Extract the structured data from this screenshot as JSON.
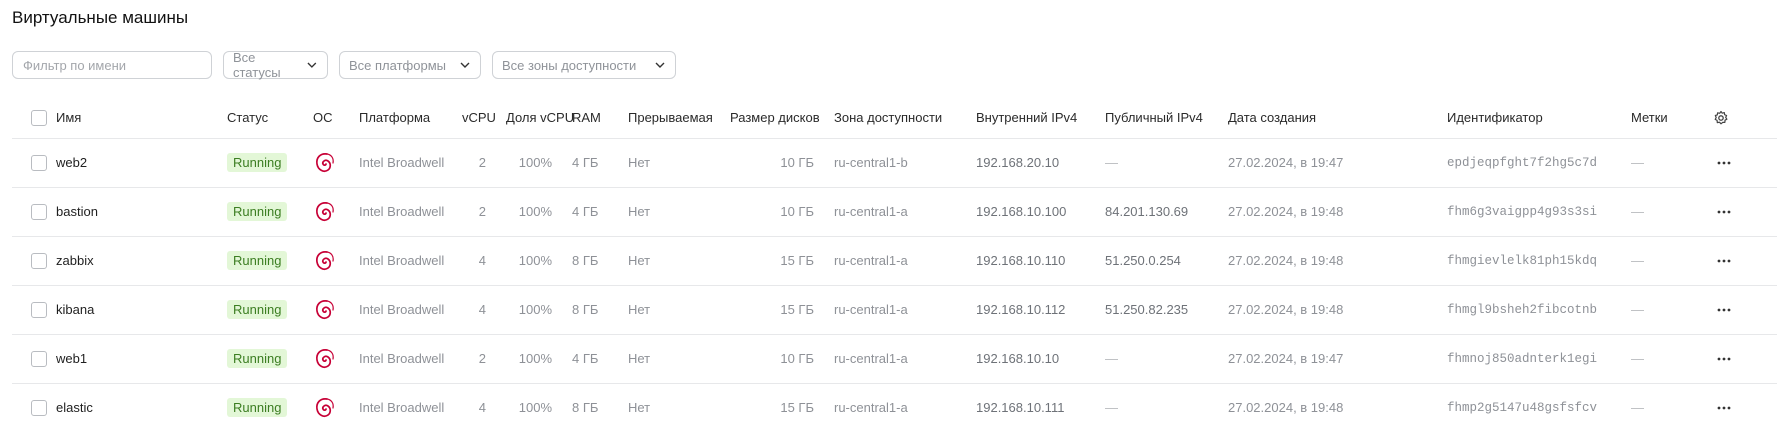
{
  "page": {
    "title": "Виртуальные машины"
  },
  "filters": {
    "name_placeholder": "Фильтр по имени",
    "status_select": "Все статусы",
    "platform_select": "Все платформы",
    "zone_select": "Все зоны доступности"
  },
  "table": {
    "headers": {
      "name": "Имя",
      "status": "Статус",
      "os": "ОС",
      "platform": "Платформа",
      "vcpu": "vCPU",
      "vcpu_share": "Доля vCPU",
      "ram": "RAM",
      "preemptible": "Прерываемая",
      "disk_size": "Размер дисков",
      "zone": "Зона доступности",
      "internal_ip": "Внутренний IPv4",
      "public_ip": "Публичный IPv4",
      "created": "Дата создания",
      "id": "Идентификатор",
      "labels": "Метки"
    },
    "rows": [
      {
        "name": "web2",
        "status": "Running",
        "os": "debian-icon",
        "platform": "Intel Broadwell",
        "vcpu": "2",
        "vcpu_share": "100%",
        "ram": "4 ГБ",
        "preemptible": "Нет",
        "disk_size": "10 ГБ",
        "zone": "ru-central1-b",
        "internal_ip": "192.168.20.10",
        "public_ip": "—",
        "created": "27.02.2024, в 19:47",
        "id": "epdjeqpfght7f2hg5c7d",
        "labels": "—"
      },
      {
        "name": "bastion",
        "status": "Running",
        "os": "debian-icon",
        "platform": "Intel Broadwell",
        "vcpu": "2",
        "vcpu_share": "100%",
        "ram": "4 ГБ",
        "preemptible": "Нет",
        "disk_size": "10 ГБ",
        "zone": "ru-central1-a",
        "internal_ip": "192.168.10.100",
        "public_ip": "84.201.130.69",
        "created": "27.02.2024, в 19:48",
        "id": "fhm6g3vaigpp4g93s3si",
        "labels": "—"
      },
      {
        "name": "zabbix",
        "status": "Running",
        "os": "debian-icon",
        "platform": "Intel Broadwell",
        "vcpu": "4",
        "vcpu_share": "100%",
        "ram": "8 ГБ",
        "preemptible": "Нет",
        "disk_size": "15 ГБ",
        "zone": "ru-central1-a",
        "internal_ip": "192.168.10.110",
        "public_ip": "51.250.0.254",
        "created": "27.02.2024, в 19:48",
        "id": "fhmgievlelk81ph15kdq",
        "labels": "—"
      },
      {
        "name": "kibana",
        "status": "Running",
        "os": "debian-icon",
        "platform": "Intel Broadwell",
        "vcpu": "4",
        "vcpu_share": "100%",
        "ram": "8 ГБ",
        "preemptible": "Нет",
        "disk_size": "15 ГБ",
        "zone": "ru-central1-a",
        "internal_ip": "192.168.10.112",
        "public_ip": "51.250.82.235",
        "created": "27.02.2024, в 19:48",
        "id": "fhmgl9bsheh2fibcotnb",
        "labels": "—"
      },
      {
        "name": "web1",
        "status": "Running",
        "os": "debian-icon",
        "platform": "Intel Broadwell",
        "vcpu": "2",
        "vcpu_share": "100%",
        "ram": "4 ГБ",
        "preemptible": "Нет",
        "disk_size": "10 ГБ",
        "zone": "ru-central1-a",
        "internal_ip": "192.168.10.10",
        "public_ip": "—",
        "created": "27.02.2024, в 19:47",
        "id": "fhmnoj850adnterk1egi",
        "labels": "—"
      },
      {
        "name": "elastic",
        "status": "Running",
        "os": "debian-icon",
        "platform": "Intel Broadwell",
        "vcpu": "4",
        "vcpu_share": "100%",
        "ram": "8 ГБ",
        "preemptible": "Нет",
        "disk_size": "15 ГБ",
        "zone": "ru-central1-a",
        "internal_ip": "192.168.10.111",
        "public_ip": "—",
        "created": "27.02.2024, в 19:48",
        "id": "fhmp2g5147u48gsfsfcv",
        "labels": "—"
      }
    ]
  },
  "colors": {
    "running_bg": "#e3f7d7",
    "running_text": "#3c7e22",
    "debian": "#c70036"
  }
}
